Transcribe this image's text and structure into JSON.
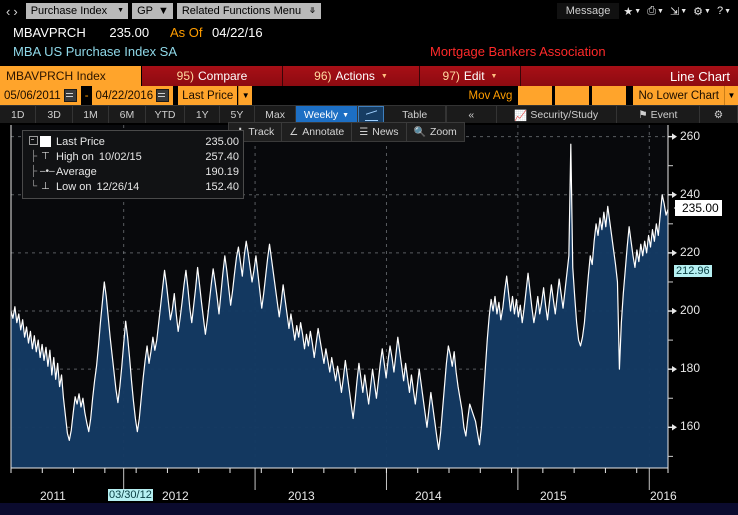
{
  "window": {
    "nav_back": "‹",
    "nav_fwd": "›",
    "ticker_label": "Purchase Index",
    "gp_label": "GP",
    "related_label": "Related Functions Menu",
    "message_label": "Message",
    "icons": [
      "star-icon",
      "screen-share-icon",
      "export-icon",
      "gear-icon",
      "help-icon"
    ]
  },
  "security": {
    "ticker": "MBAVPRCH",
    "last_price": "235.00",
    "asof_label": "As Of",
    "asof_date": "04/22/16",
    "name": "MBA US Purchase Index SA",
    "provider": "Mortgage Bankers Association"
  },
  "function_bar": {
    "security_field": "MBAVPRCH Index",
    "items": [
      {
        "num": "95)",
        "label": "Compare",
        "caret": false
      },
      {
        "num": "96)",
        "label": "Actions",
        "caret": true
      },
      {
        "num": "97)",
        "label": "Edit",
        "caret": true
      }
    ],
    "chart_type": "Line Chart"
  },
  "params": {
    "start_date": "05/06/2011",
    "range_dash": "-",
    "end_date": "04/22/2016",
    "price_field": "Last Price",
    "mov_avg_label": "Mov Avg",
    "mov_avg_values": [
      "",
      "",
      ""
    ],
    "lower_chart": "No Lower Chart"
  },
  "tabs": {
    "periods": [
      "1D",
      "3D",
      "1M",
      "6M",
      "YTD",
      "1Y",
      "5Y",
      "Max"
    ],
    "frequency": "Weekly",
    "table_label": "Table",
    "collapse": "«",
    "security_study": "Security/Study",
    "event": "Event",
    "settings_icon": "gear-icon"
  },
  "tools": [
    {
      "icon": "track-crosshair-icon",
      "label": "Track"
    },
    {
      "icon": "annotate-angle-icon",
      "label": "Annotate"
    },
    {
      "icon": "news-lines-icon",
      "label": "News"
    },
    {
      "icon": "zoom-magnifier-icon",
      "label": "Zoom"
    }
  ],
  "legend": {
    "rows": [
      {
        "glyph": "box-collapse",
        "swatch": true,
        "name": "Last Price",
        "date": "",
        "value": "235.00"
      },
      {
        "glyph": "high-tick",
        "swatch": false,
        "name": "High on",
        "date": "10/02/15",
        "value": "257.40"
      },
      {
        "glyph": "avg-dot",
        "swatch": false,
        "name": "Average",
        "date": "",
        "value": "190.19"
      },
      {
        "glyph": "low-tick",
        "swatch": false,
        "name": "Low on",
        "date": "12/26/14",
        "value": "152.40"
      }
    ]
  },
  "markers": {
    "last_callout": "235.00",
    "average_label": "212.96",
    "date_marker": "03/30/12"
  },
  "colors": {
    "line": "#ffffff",
    "area_fill": "#143a63",
    "accent_orange": "#ffa42b",
    "accent_red": "#a80f16",
    "cyan": "#b6f0f2",
    "grid": "#9aa0a6"
  },
  "chart_data": {
    "type": "area",
    "title": "MBA US Purchase Index SA",
    "subtitle": "Mortgage Bankers Association",
    "xlabel": "",
    "ylabel": "",
    "ylim": [
      146,
      264
    ],
    "yticks": [
      160,
      180,
      200,
      220,
      240,
      260
    ],
    "yminor": [
      150,
      170,
      190,
      210,
      230,
      250
    ],
    "grid": true,
    "legend_position": "top-left",
    "series_name": "Last Price",
    "frequency": "Weekly",
    "x_start": "05/06/2011",
    "x_end": "04/22/2016",
    "xticks": [
      "2011",
      "2012",
      "2013",
      "2014",
      "2015",
      "2016"
    ],
    "annotations": [
      {
        "label": "High on 10/02/15",
        "value": 257.4
      },
      {
        "label": "Low on 12/26/14",
        "value": 152.4
      },
      {
        "label": "Average",
        "value": 190.19
      },
      {
        "label": "Last Price",
        "value": 235.0
      },
      {
        "label": "Average line",
        "value": 212.96
      },
      {
        "label": "Date marker",
        "value": "03/30/12"
      }
    ],
    "values": [
      200.0,
      197.5,
      201.5,
      196.0,
      199.0,
      193.5,
      197.0,
      191.0,
      194.5,
      189.0,
      193.0,
      187.0,
      191.5,
      186.0,
      190.0,
      184.0,
      188.5,
      183.0,
      187.5,
      181.0,
      186.5,
      178.0,
      184.0,
      176.5,
      182.0,
      174.0,
      178.0,
      170.0,
      164.0,
      158.0,
      155.5,
      159.0,
      165.0,
      170.5,
      168.0,
      171.5,
      167.0,
      170.0,
      165.0,
      161.5,
      158.5,
      163.0,
      170.0,
      176.0,
      181.0,
      188.0,
      196.0,
      203.0,
      210.0,
      205.0,
      198.0,
      191.0,
      185.0,
      179.0,
      173.0,
      168.5,
      174.0,
      181.0,
      189.0,
      196.5,
      191.0,
      184.0,
      176.0,
      169.0,
      163.0,
      158.5,
      163.0,
      170.0,
      177.0,
      183.0,
      188.0,
      182.0,
      186.0,
      191.0,
      186.5,
      190.0,
      196.0,
      202.0,
      208.0,
      214.0,
      209.0,
      203.0,
      197.0,
      200.5,
      206.0,
      199.0,
      193.0,
      197.5,
      203.0,
      209.0,
      214.0,
      208.0,
      201.0,
      196.0,
      202.0,
      208.0,
      215.0,
      209.0,
      203.0,
      197.5,
      192.0,
      197.0,
      203.0,
      209.0,
      214.5,
      210.0,
      205.0,
      199.0,
      206.0,
      213.0,
      219.0,
      214.0,
      208.0,
      202.0,
      207.0,
      213.0,
      218.5,
      222.0,
      217.0,
      212.0,
      219.0,
      224.0,
      220.0,
      215.0,
      210.0,
      214.0,
      219.0,
      213.0,
      207.0,
      201.0,
      206.0,
      212.0,
      218.0,
      223.0,
      218.0,
      213.0,
      208.0,
      203.0,
      198.0,
      203.0,
      209.0,
      204.0,
      199.0,
      194.0,
      199.0,
      194.5,
      190.0,
      195.0,
      191.0,
      196.0,
      192.0,
      187.0,
      192.0,
      188.0,
      193.0,
      189.0,
      184.0,
      189.0,
      194.0,
      190.0,
      186.0,
      182.0,
      187.0,
      183.0,
      179.0,
      184.0,
      180.0,
      176.0,
      181.0,
      177.0,
      172.0,
      177.0,
      183.0,
      178.0,
      173.0,
      168.0,
      163.0,
      169.0,
      176.0,
      182.0,
      177.0,
      172.0,
      178.0,
      173.0,
      168.0,
      174.0,
      180.0,
      175.0,
      170.0,
      176.0,
      182.0,
      187.0,
      182.0,
      177.0,
      183.0,
      188.0,
      184.0,
      179.0,
      185.0,
      191.0,
      186.0,
      181.0,
      176.0,
      182.0,
      177.0,
      172.0,
      178.0,
      173.0,
      168.0,
      174.0,
      180.0,
      175.0,
      170.0,
      165.0,
      160.0,
      166.0,
      172.0,
      167.0,
      162.0,
      157.0,
      152.4,
      158.0,
      166.0,
      174.0,
      182.0,
      188.0,
      185.0,
      181.0,
      186.0,
      179.0,
      174.0,
      170.0,
      166.0,
      160.0,
      157.0,
      163.0,
      168.0,
      166.0,
      164.0,
      162.0,
      158.0,
      154.0,
      160.0,
      170.0,
      180.0,
      190.0,
      198.0,
      204.0,
      200.0,
      205.0,
      199.0,
      203.0,
      197.0,
      201.0,
      207.0,
      212.0,
      206.0,
      200.0,
      205.0,
      199.0,
      204.0,
      198.0,
      202.0,
      196.0,
      201.0,
      207.0,
      213.0,
      207.0,
      201.0,
      196.0,
      200.0,
      205.0,
      199.0,
      203.0,
      208.0,
      202.0,
      197.0,
      203.0,
      209.0,
      204.0,
      199.0,
      205.0,
      211.0,
      206.0,
      201.0,
      207.0,
      213.0,
      219.0,
      257.4,
      215.0,
      205.0,
      196.0,
      190.0,
      188.0,
      191.0,
      196.0,
      204.0,
      212.0,
      219.0,
      216.0,
      224.0,
      230.0,
      226.0,
      232.0,
      228.0,
      234.0,
      229.0,
      236.0,
      231.0,
      226.0,
      221.0,
      216.0,
      210.0,
      180.0,
      196.0,
      206.0,
      214.0,
      222.0,
      229.0,
      224.0,
      219.0,
      215.0,
      221.0,
      217.0,
      223.0,
      219.0,
      224.0,
      220.0,
      226.0,
      222.0,
      228.0,
      224.0,
      230.0,
      226.0,
      233.0,
      240.0,
      237.0,
      233.0,
      235.0
    ]
  }
}
